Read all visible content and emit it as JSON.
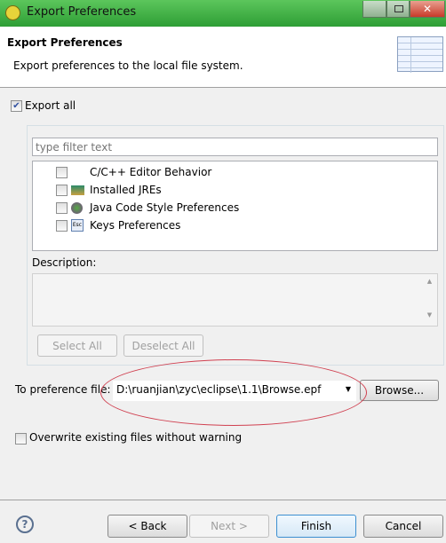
{
  "window": {
    "title": "Export Preferences"
  },
  "header": {
    "title": "Export Preferences",
    "description": "Export preferences to the local file system."
  },
  "export_all": {
    "label": "Export all",
    "checked": true
  },
  "filter": {
    "placeholder": "type filter text",
    "value": ""
  },
  "tree": {
    "items": [
      {
        "label": "C/C++ Editor Behavior",
        "icon": "none",
        "checked": false
      },
      {
        "label": "Installed JREs",
        "icon": "jre-icon",
        "checked": false
      },
      {
        "label": "Java Code Style Preferences",
        "icon": "java-style-icon",
        "checked": false
      },
      {
        "label": "Keys Preferences",
        "icon": "keys-icon",
        "checked": false
      }
    ]
  },
  "description": {
    "label": "Description:",
    "value": ""
  },
  "buttons": {
    "select_all": "Select All",
    "deselect_all": "Deselect All",
    "browse": "Browse...",
    "back": "< Back",
    "next": "Next >",
    "finish": "Finish",
    "cancel": "Cancel"
  },
  "file": {
    "label": "To preference file:",
    "value": "D:\\ruanjian\\zyc\\eclipse\\1.1\\Browse.epf"
  },
  "overwrite": {
    "label": "Overwrite existing files without warning",
    "checked": false
  },
  "annotation_color": "#d04050"
}
